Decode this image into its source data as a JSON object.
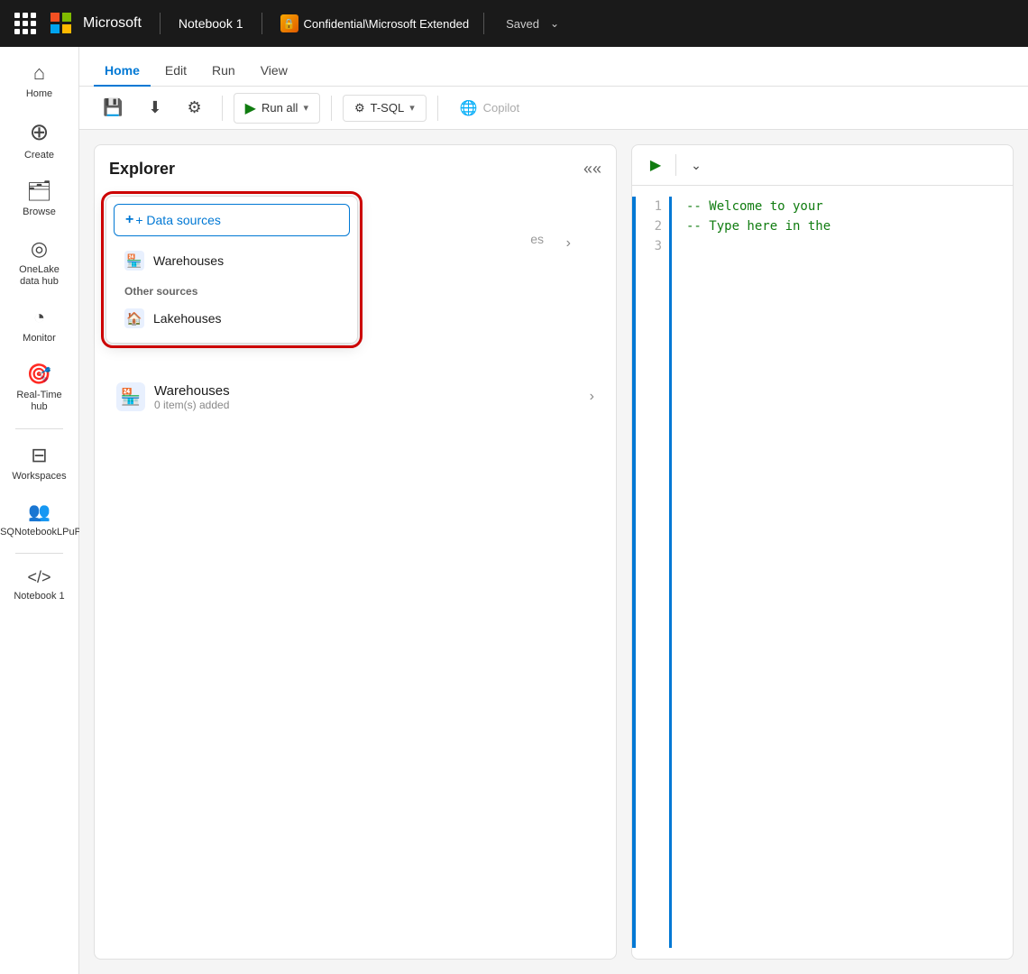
{
  "topbar": {
    "app_name": "Microsoft",
    "notebook_name": "Notebook 1",
    "confidential_label": "Confidential\\Microsoft Extended",
    "status": "Saved",
    "dots_label": "App launcher"
  },
  "menu": {
    "tabs": [
      {
        "label": "Home",
        "active": true
      },
      {
        "label": "Edit",
        "active": false
      },
      {
        "label": "Run",
        "active": false
      },
      {
        "label": "View",
        "active": false
      }
    ]
  },
  "toolbar": {
    "save_label": "Save",
    "download_label": "Download",
    "settings_label": "Settings",
    "run_all_label": "Run all",
    "tsql_label": "T-SQL",
    "copilot_label": "Copilot"
  },
  "sidebar": {
    "items": [
      {
        "label": "Home",
        "icon": "⌂"
      },
      {
        "label": "Create",
        "icon": "⊕"
      },
      {
        "label": "Browse",
        "icon": "📁"
      },
      {
        "label": "OneLake data hub",
        "icon": "◎"
      },
      {
        "label": "Monitor",
        "icon": "◔"
      },
      {
        "label": "Real-Time hub",
        "icon": "⛁"
      },
      {
        "label": "Workspaces",
        "icon": "⊟"
      },
      {
        "label": "TSQNotebookLPuPr",
        "icon": "👥"
      },
      {
        "label": "Notebook 1",
        "icon": "</>"
      }
    ]
  },
  "explorer": {
    "title": "Explorer",
    "collapse_tooltip": "Collapse",
    "dropdown": {
      "data_sources_label": "+ Data sources",
      "warehouses_label": "Warehouses",
      "other_sources_label": "Other sources",
      "lakehouses_label": "Lakehouses"
    },
    "rows": [
      {
        "title": "Warehouses",
        "subtitle": "0 item(s) added"
      }
    ],
    "placeholder_text": "es"
  },
  "code_editor": {
    "lines": [
      {
        "num": "1",
        "text": "-- Welcome to your"
      },
      {
        "num": "2",
        "text": "-- Type here in the"
      },
      {
        "num": "3",
        "text": ""
      }
    ]
  }
}
